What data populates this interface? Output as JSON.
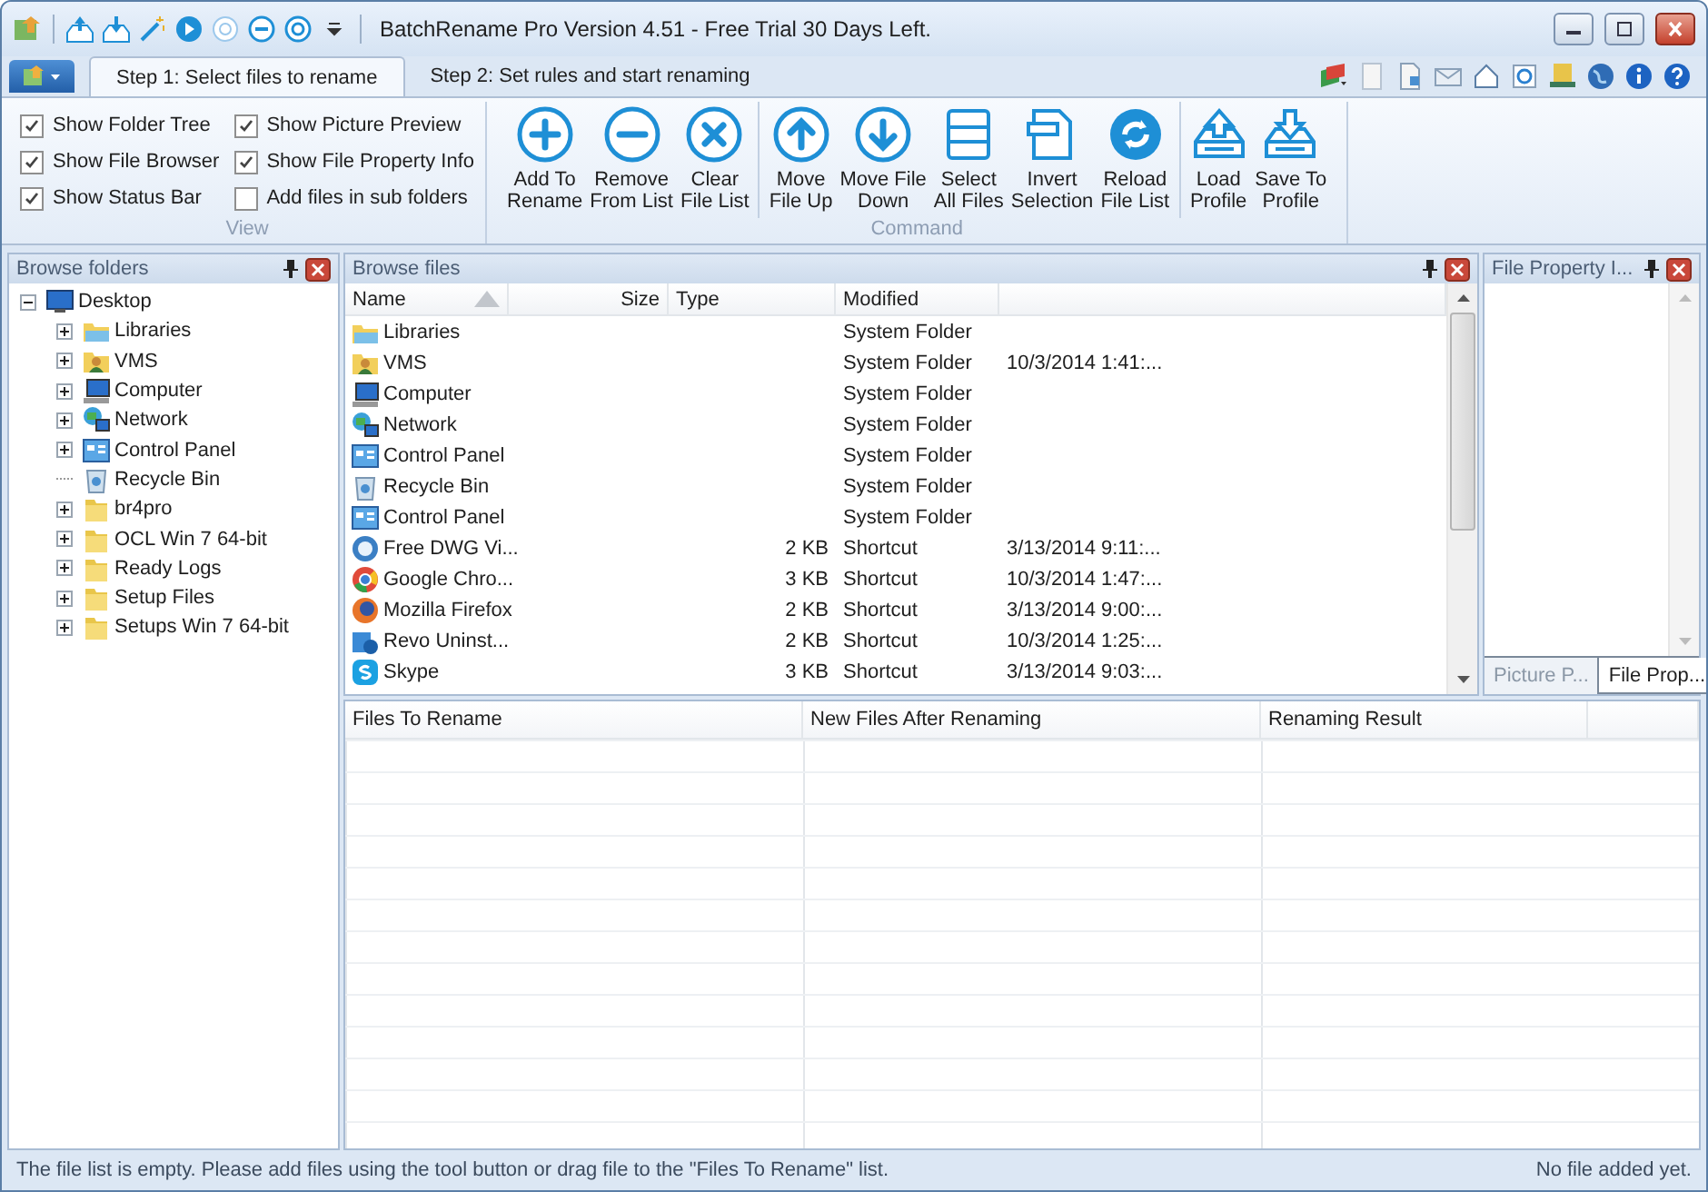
{
  "window": {
    "title": "BatchRename Pro Version 4.51 - Free Trial 30 Days Left."
  },
  "tabs": [
    {
      "label": "Step 1: Select files to rename",
      "selected": true
    },
    {
      "label": "Step 2: Set rules and start renaming",
      "selected": false
    }
  ],
  "ribbon": {
    "view_group": {
      "label": "View",
      "options": [
        {
          "label": "Show Folder Tree",
          "checked": true
        },
        {
          "label": "Show File Browser",
          "checked": true
        },
        {
          "label": "Show Status Bar",
          "checked": true
        },
        {
          "label": "Show Picture Preview",
          "checked": true
        },
        {
          "label": "Show File Property Info",
          "checked": true
        },
        {
          "label": "Add files in sub folders",
          "checked": false
        }
      ]
    },
    "command_group": {
      "label": "Command",
      "sections": [
        [
          {
            "label": "Add To\nRename"
          },
          {
            "label": "Remove\nFrom List"
          },
          {
            "label": "Clear\nFile List"
          }
        ],
        [
          {
            "label": "Move\nFile Up"
          },
          {
            "label": "Move File\nDown"
          },
          {
            "label": "Select\nAll Files"
          },
          {
            "label": "Invert\nSelection"
          },
          {
            "label": "Reload\nFile List"
          }
        ],
        [
          {
            "label": "Load\nProfile"
          },
          {
            "label": "Save To\nProfile"
          }
        ]
      ]
    }
  },
  "folders_panel": {
    "title": "Browse folders",
    "tree": [
      {
        "label": "Desktop",
        "expandable": true,
        "expanded": true,
        "children": [
          {
            "label": "Libraries",
            "expandable": true,
            "expanded": false
          },
          {
            "label": "VMS",
            "expandable": true,
            "expanded": false
          },
          {
            "label": "Computer",
            "expandable": true,
            "expanded": false
          },
          {
            "label": "Network",
            "expandable": true,
            "expanded": false
          },
          {
            "label": "Control Panel",
            "expandable": true,
            "expanded": false
          },
          {
            "label": "Recycle Bin",
            "expandable": false
          },
          {
            "label": "br4pro",
            "expandable": true,
            "expanded": false
          },
          {
            "label": "OCL Win 7 64-bit",
            "expandable": true,
            "expanded": false
          },
          {
            "label": "Ready Logs",
            "expandable": true,
            "expanded": false
          },
          {
            "label": "Setup Files",
            "expandable": true,
            "expanded": false
          },
          {
            "label": "Setups Win 7 64-bit",
            "expandable": true,
            "expanded": false
          }
        ]
      }
    ]
  },
  "files_panel": {
    "title": "Browse files",
    "columns": [
      {
        "label": "Name",
        "sorted": true
      },
      {
        "label": "Size",
        "sorted": false
      },
      {
        "label": "Type",
        "sorted": false
      },
      {
        "label": "Modified",
        "sorted": false
      }
    ],
    "rows": [
      {
        "name": "Libraries",
        "size": "",
        "type": "System Folder",
        "modified": ""
      },
      {
        "name": "VMS",
        "size": "",
        "type": "System Folder",
        "modified": "10/3/2014 1:41:..."
      },
      {
        "name": "Computer",
        "size": "",
        "type": "System Folder",
        "modified": ""
      },
      {
        "name": "Network",
        "size": "",
        "type": "System Folder",
        "modified": ""
      },
      {
        "name": "Control Panel",
        "size": "",
        "type": "System Folder",
        "modified": ""
      },
      {
        "name": "Recycle Bin",
        "size": "",
        "type": "System Folder",
        "modified": ""
      },
      {
        "name": "Control Panel",
        "size": "",
        "type": "System Folder",
        "modified": ""
      },
      {
        "name": "Free DWG Vi...",
        "size": "2 KB",
        "type": "Shortcut",
        "modified": "3/13/2014 9:11:..."
      },
      {
        "name": "Google Chro...",
        "size": "3 KB",
        "type": "Shortcut",
        "modified": "10/3/2014 1:47:..."
      },
      {
        "name": "Mozilla Firefox",
        "size": "2 KB",
        "type": "Shortcut",
        "modified": "3/13/2014 9:00:..."
      },
      {
        "name": "Revo Uninst...",
        "size": "2 KB",
        "type": "Shortcut",
        "modified": "10/3/2014 1:25:..."
      },
      {
        "name": "Skype",
        "size": "3 KB",
        "type": "Shortcut",
        "modified": "3/13/2014 9:03:..."
      }
    ]
  },
  "property_panel": {
    "title": "File Property I...",
    "tabs": [
      {
        "label": "Picture P...",
        "selected": false
      },
      {
        "label": "File Prop...",
        "selected": true
      }
    ]
  },
  "rename_list": {
    "columns": [
      "Files To Rename",
      "New Files After Renaming",
      "Renaming Result"
    ]
  },
  "status_bar": {
    "message": "The file list is empty. Please add files using the tool button or drag file to the \"Files To Rename\" list.",
    "count": "No file added yet."
  }
}
